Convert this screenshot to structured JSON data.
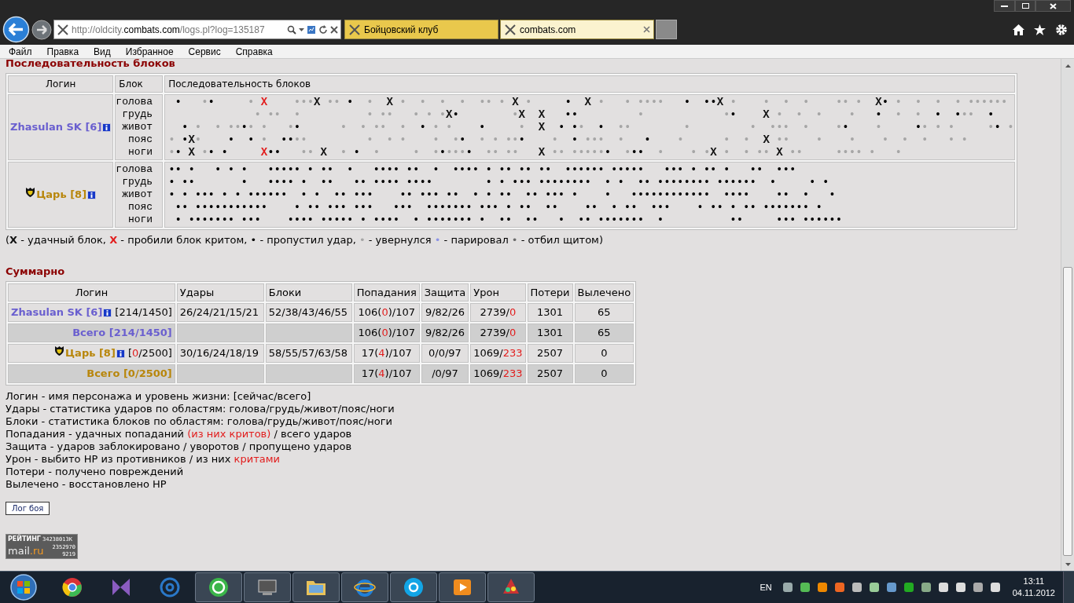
{
  "browser": {
    "address": {
      "prefix": "http://oldcity.",
      "domain": "combats.com",
      "path": "/logs.pl?log=135187"
    },
    "tabs": [
      {
        "title": "Бойцовский клуб",
        "selected": false
      },
      {
        "title": "combats.com",
        "selected": true
      }
    ],
    "menu": [
      "Файл",
      "Правка",
      "Вид",
      "Избранное",
      "Сервис",
      "Справка"
    ]
  },
  "blocks": {
    "title": "Последовательность блоков",
    "columns": [
      "Логин",
      "Блок",
      "Последовательность блоков"
    ],
    "fighters": [
      {
        "name": "Zhasulan SK [6]",
        "color": "#6a5fcf",
        "clan_badge": false,
        "zones": [
          {
            "label": "голова",
            "marks": [
              {
                "kind": "hit",
                "text": " •"
              },
              {
                "kind": "dodge",
                "text": "   •"
              },
              {
                "kind": "hit",
                "text": "•"
              },
              {
                "kind": "dodge",
                "text": "     •"
              },
              {
                "kind": "crit",
                "text": " X"
              },
              {
                "kind": "dodge",
                "text": "    •••"
              },
              {
                "kind": "block",
                "text": "X"
              },
              {
                "kind": "dodge",
                "text": " ••"
              },
              {
                "kind": "hit",
                "text": " •"
              },
              {
                "kind": "dodge",
                "text": "  •"
              },
              {
                "kind": "block",
                "text": "  X"
              },
              {
                "kind": "dodge",
                "text": " •  •  •  •  •• •"
              },
              {
                "kind": "block",
                "text": " X"
              },
              {
                "kind": "dodge",
                "text": " •"
              },
              {
                "kind": "hit",
                "text": "     •"
              },
              {
                "kind": "block",
                "text": "  X"
              },
              {
                "kind": "dodge",
                "text": " •   • ••••"
              },
              {
                "kind": "hit",
                "text": "   •  ••"
              },
              {
                "kind": "block",
                "text": "X"
              },
              {
                "kind": "dodge",
                "text": " •    •  •  •    •• •"
              },
              {
                "kind": "block",
                "text": "  X"
              },
              {
                "kind": "hit",
                "text": "•"
              },
              {
                "kind": "dodge",
                "text": " •  •  •  • ••••••"
              }
            ]
          },
          {
            "label": "грудь",
            "marks": [
              {
                "kind": "dodge",
                "text": "             • ••  •          • ••   • • •"
              },
              {
                "kind": "block",
                "text": "X"
              },
              {
                "kind": "hit",
                "text": "•"
              },
              {
                "kind": "dodge",
                "text": "        •"
              },
              {
                "kind": "block",
                "text": "X  X"
              },
              {
                "kind": "hit",
                "text": "   ••"
              },
              {
                "kind": "dodge",
                "text": "         •            •"
              },
              {
                "kind": "hit",
                "text": "•"
              },
              {
                "kind": "block",
                "text": "    X"
              },
              {
                "kind": "dodge",
                "text": " •  •  •    •"
              },
              {
                "kind": "hit",
                "text": "   •"
              },
              {
                "kind": "dodge",
                "text": "  •  •"
              },
              {
                "kind": "hit",
                "text": "  •  •"
              },
              {
                "kind": "dodge",
                "text": "••"
              },
              {
                "kind": "hit",
                "text": "  •"
              }
            ]
          },
          {
            "label": "живот",
            "marks": [
              {
                "kind": "hit",
                "text": "  •"
              },
              {
                "kind": "dodge",
                "text": " •  • ••"
              },
              {
                "kind": "hit",
                "text": "•"
              },
              {
                "kind": "dodge",
                "text": "• •   •"
              },
              {
                "kind": "hit",
                "text": "•"
              },
              {
                "kind": "dodge",
                "text": "      •  • ••  •"
              },
              {
                "kind": "hit",
                "text": "  •"
              },
              {
                "kind": "dodge",
                "text": " • •"
              },
              {
                "kind": "hit",
                "text": "    •"
              },
              {
                "kind": "dodge",
                "text": "     •"
              },
              {
                "kind": "block",
                "text": "  X"
              },
              {
                "kind": "hit",
                "text": "  • •"
              },
              {
                "kind": "dodge",
                "text": "•"
              },
              {
                "kind": "hit",
                "text": "  •"
              },
              {
                "kind": "dodge",
                "text": "  ••        •         •  •••  •    •"
              },
              {
                "kind": "hit",
                "text": "•"
              },
              {
                "kind": "dodge",
                "text": "    •"
              },
              {
                "kind": "hit",
                "text": "     •"
              },
              {
                "kind": "dodge",
                "text": "• • •     •"
              },
              {
                "kind": "hit",
                "text": "•"
              },
              {
                "kind": "dodge",
                "text": " •"
              }
            ]
          },
          {
            "label": "пояс",
            "marks": [
              {
                "kind": "dodge",
                "text": "•"
              },
              {
                "kind": "hit",
                "text": " •"
              },
              {
                "kind": "block",
                "text": "X"
              },
              {
                "kind": "dodge",
                "text": "•"
              },
              {
                "kind": "hit",
                "text": "    •  •"
              },
              {
                "kind": "dodge",
                "text": " •"
              },
              {
                "kind": "hit",
                "text": "  ••"
              },
              {
                "kind": "dodge",
                "text": "••         •  • •    •  •"
              },
              {
                "kind": "hit",
                "text": "•"
              },
              {
                "kind": "dodge",
                "text": "  • • ••"
              },
              {
                "kind": "hit",
                "text": "•"
              },
              {
                "kind": "dodge",
                "text": "    •"
              },
              {
                "kind": "hit",
                "text": "  •"
              },
              {
                "kind": "dodge",
                "text": " •••  •"
              },
              {
                "kind": "hit",
                "text": "   •"
              },
              {
                "kind": "dodge",
                "text": "    •      •  •"
              },
              {
                "kind": "block",
                "text": "  X"
              },
              {
                "kind": "dodge",
                "text": " ••    •    •    •  •  •   • •"
              }
            ]
          },
          {
            "label": "ноги",
            "marks": [
              {
                "kind": "dodge",
                "text": "•"
              },
              {
                "kind": "hit",
                "text": "•"
              },
              {
                "kind": "block",
                "text": " X"
              },
              {
                "kind": "dodge",
                "text": " •"
              },
              {
                "kind": "hit",
                "text": "• •"
              },
              {
                "kind": "crit",
                "text": "     X"
              },
              {
                "kind": "hit",
                "text": "••"
              },
              {
                "kind": "dodge",
                "text": "   ••"
              },
              {
                "kind": "block",
                "text": " X"
              },
              {
                "kind": "dodge",
                "text": "  •"
              },
              {
                "kind": "hit",
                "text": " •"
              },
              {
                "kind": "dodge",
                "text": "  •     •  •"
              },
              {
                "kind": "hit",
                "text": "•"
              },
              {
                "kind": "dodge",
                "text": "•••"
              },
              {
                "kind": "hit",
                "text": "•"
              },
              {
                "kind": "dodge",
                "text": "  •• ••"
              },
              {
                "kind": "block",
                "text": "   X"
              },
              {
                "kind": "dodge",
                "text": " •• •••••"
              },
              {
                "kind": "hit",
                "text": "•"
              },
              {
                "kind": "dodge",
                "text": "  •"
              },
              {
                "kind": "hit",
                "text": "••"
              },
              {
                "kind": "dodge",
                "text": "  •    • •"
              },
              {
                "kind": "block",
                "text": "X"
              },
              {
                "kind": "dodge",
                "text": " •  • ••"
              },
              {
                "kind": "block",
                "text": " X"
              },
              {
                "kind": "dodge",
                "text": " ••     •••• •   •"
              }
            ]
          }
        ]
      },
      {
        "name": "Царь [8]",
        "color": "#b8860b",
        "clan_badge": true,
        "zones": [
          {
            "label": "голова",
            "marks": [
              {
                "kind": "hit",
                "text": "•• •   • • •   ••••• • ••  •   •••• ••  •  •••• • •• •• ••  •••••• •••••   ••• • •• •   ••  •••"
              }
            ]
          },
          {
            "label": "грудь",
            "marks": [
              {
                "kind": "hit",
                "text": "• ••       •   •••• •  ••   •• •••• ••••        • • ••• ••••••••  • •  •• •••••••• ••••••  •     • •"
              }
            ]
          },
          {
            "label": "живот",
            "marks": [
              {
                "kind": "hit",
                "text": "• • ••• • • ••••••  • •  •• •••    •• ••• ••  • • ••  •• ••• •    •   ••••••••••••  ••••    ••  •   •"
              }
            ]
          },
          {
            "label": "пояс",
            "marks": [
              {
                "kind": "hit",
                "text": " •• •••••••••••    • •• ••• •••   •••  ••••••• ••• • ••  ••    ••  • ••  •••    • •• • •• ••••••• •"
              }
            ]
          },
          {
            "label": "ноги",
            "marks": [
              {
                "kind": "hit",
                "text": " • ••••••• •••    •••• ••••• • ••••  • ••••••• •  ••  ••   •  •• •••••••  •          ••     ••• ••••••"
              }
            ]
          }
        ]
      }
    ],
    "legend": {
      "opening": "(",
      "items": [
        {
          "kind": "block",
          "symbol": "X",
          "text": " - удачный блок, "
        },
        {
          "kind": "crit",
          "symbol": "X",
          "text": " - пробили блок критом, "
        },
        {
          "kind": "hit",
          "symbol": "•",
          "text": " - пропустил удар, "
        },
        {
          "kind": "dodge",
          "symbol": "•",
          "text": " - увернулся "
        },
        {
          "kind": "parry",
          "symbol": "•",
          "text": " - парировал "
        },
        {
          "kind": "shield",
          "symbol": "•",
          "text": " - отбил щитом)"
        }
      ]
    }
  },
  "summary": {
    "title": "Суммарно",
    "login_column": "Логин",
    "columns": [
      "Удары",
      "Блоки",
      "Попадания",
      "Защита",
      "Урон",
      "Потери",
      "Вылечено"
    ],
    "rows": [
      {
        "kind": "fighter",
        "name": "Zhasulan SK [6]",
        "color": "#6a5fcf",
        "clan_badge": false,
        "hp": [
          {
            "text": "[214/1450]",
            "crit": false
          }
        ],
        "cells": [
          [
            {
              "text": "26/24/21/15/21",
              "crit": false
            }
          ],
          [
            {
              "text": "52/38/43/46/55",
              "crit": false
            }
          ],
          [
            {
              "text": "106(",
              "crit": false
            },
            {
              "text": "0",
              "crit": true
            },
            {
              "text": ")/107",
              "crit": false
            }
          ],
          [
            {
              "text": "9/82/26",
              "crit": false
            }
          ],
          [
            {
              "text": "2739/",
              "crit": false
            },
            {
              "text": "0",
              "crit": true
            }
          ],
          [
            {
              "text": "1301",
              "crit": false
            }
          ],
          [
            {
              "text": "65",
              "crit": false
            }
          ]
        ]
      },
      {
        "kind": "total",
        "name": "Всего [214/1450]",
        "color": "#6a5fcf",
        "cells": [
          "",
          "",
          [
            {
              "text": "106(",
              "crit": false
            },
            {
              "text": "0",
              "crit": true
            },
            {
              "text": ")/107",
              "crit": false
            }
          ],
          [
            {
              "text": "9/82/26",
              "crit": false
            }
          ],
          [
            {
              "text": "2739/",
              "crit": false
            },
            {
              "text": "0",
              "crit": true
            }
          ],
          [
            {
              "text": "1301",
              "crit": false
            }
          ],
          [
            {
              "text": "65",
              "crit": false
            }
          ]
        ]
      },
      {
        "kind": "fighter",
        "name": "Царь [8]",
        "color": "#b8860b",
        "clan_badge": true,
        "hp": [
          {
            "text": "[",
            "crit": false
          },
          {
            "text": "0",
            "crit": true
          },
          {
            "text": "/2500]",
            "crit": false
          }
        ],
        "cells": [
          [
            {
              "text": "30/16/24/18/19",
              "crit": false
            }
          ],
          [
            {
              "text": "58/55/57/63/58",
              "crit": false
            }
          ],
          [
            {
              "text": "17(",
              "crit": false
            },
            {
              "text": "4",
              "crit": true
            },
            {
              "text": ")/107",
              "crit": false
            }
          ],
          [
            {
              "text": "0/0/97",
              "crit": false
            }
          ],
          [
            {
              "text": "1069/",
              "crit": false
            },
            {
              "text": "233",
              "crit": true
            }
          ],
          [
            {
              "text": "2507",
              "crit": false
            }
          ],
          [
            {
              "text": "0",
              "crit": false
            }
          ]
        ]
      },
      {
        "kind": "total",
        "name": "Всего [0/2500]",
        "color": "#b8860b",
        "cells": [
          "",
          "",
          [
            {
              "text": "17(",
              "crit": false
            },
            {
              "text": "4",
              "crit": true
            },
            {
              "text": ")/107",
              "crit": false
            }
          ],
          [
            {
              "text": "/0/97",
              "crit": false
            }
          ],
          [
            {
              "text": "1069/",
              "crit": false
            },
            {
              "text": "233",
              "crit": true
            }
          ],
          [
            {
              "text": "2507",
              "crit": false
            }
          ],
          [
            {
              "text": "0",
              "crit": false
            }
          ]
        ]
      }
    ]
  },
  "notes": [
    [
      {
        "text": "Логин - имя персонажа и уровень жизни: [сейчас/всего]",
        "crit": false
      }
    ],
    [
      {
        "text": "Удары - статистика ударов по областям: голова/грудь/живот/пояс/ноги",
        "crit": false
      }
    ],
    [
      {
        "text": "Блоки - статистика блоков по областям: голова/грудь/живот/пояс/ноги",
        "crit": false
      }
    ],
    [
      {
        "text": "Попадания - удачных попаданий ",
        "crit": false
      },
      {
        "text": "(из них критов)",
        "crit": true
      },
      {
        "text": " / всего ударов",
        "crit": false
      }
    ],
    [
      {
        "text": "Защита - ударов заблокировано / уворотов / пропущено ударов",
        "crit": false
      }
    ],
    [
      {
        "text": "Урон - выбито HP из противников / из них ",
        "crit": false
      },
      {
        "text": "критами",
        "crit": true
      }
    ],
    [
      {
        "text": "Потери - получено повреждений",
        "crit": false
      }
    ],
    [
      {
        "text": "Вылечено - восстановлено HP",
        "crit": false
      }
    ]
  ],
  "log_button": "Лог боя",
  "counter": {
    "label": "РЕЙТИНГ",
    "value_1": "34238013K",
    "brand_1": "mail",
    "brand_2": ".ru",
    "value_2": "2352970",
    "value_3": "9219"
  },
  "taskbar": {
    "language": "EN",
    "time": "13:11",
    "date": "04.11.2012"
  }
}
